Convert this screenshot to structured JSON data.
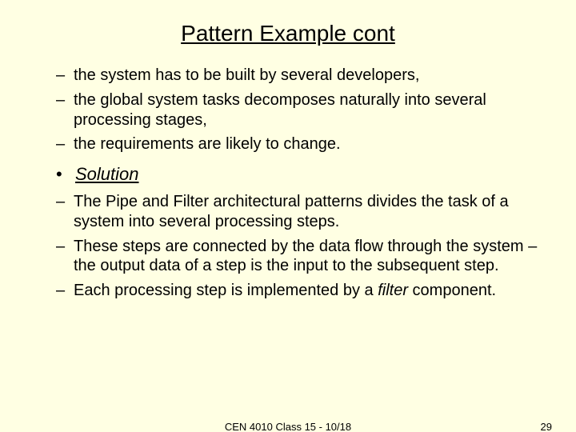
{
  "title": "Pattern Example cont",
  "context_bullets": [
    "the system has to be built by several developers,",
    "the global system tasks decomposes naturally into several processing stages,",
    "the requirements are likely to change."
  ],
  "solution_label": "Solution",
  "solution_bullets": [
    {
      "pre": "The Pipe and Filter architectural patterns divides the task of a system into several processing steps.",
      "italic": "",
      "post": ""
    },
    {
      "pre": "These steps are connected by the data flow through the system – the output data of a step is the input to the subsequent step.",
      "italic": "",
      "post": ""
    },
    {
      "pre": "Each processing step is implemented by a ",
      "italic": "filter",
      "post": " component."
    }
  ],
  "footer_center": "CEN 4010 Class 15 - 10/18",
  "footer_right": "29"
}
